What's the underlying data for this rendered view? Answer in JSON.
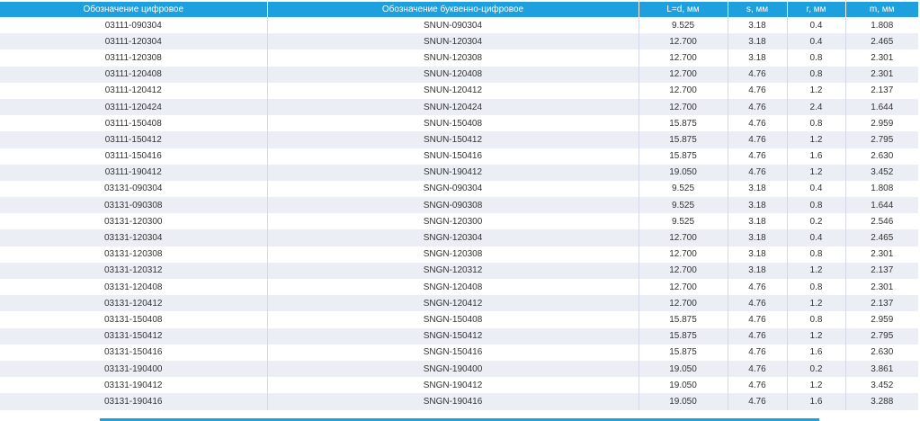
{
  "table": {
    "headers": [
      "Обозначение цифровое",
      "Обозначение буквенно-цифровое",
      "L=d, мм",
      "s, мм",
      "r, мм",
      "m, мм"
    ],
    "rows": [
      [
        "03111-090304",
        "SNUN-090304",
        "9.525",
        "3.18",
        "0.4",
        "1.808"
      ],
      [
        "03111-120304",
        "SNUN-120304",
        "12.700",
        "3.18",
        "0.4",
        "2.465"
      ],
      [
        "03111-120308",
        "SNUN-120308",
        "12.700",
        "3.18",
        "0.8",
        "2.301"
      ],
      [
        "03111-120408",
        "SNUN-120408",
        "12.700",
        "4.76",
        "0.8",
        "2.301"
      ],
      [
        "03111-120412",
        "SNUN-120412",
        "12.700",
        "4.76",
        "1.2",
        "2.137"
      ],
      [
        "03111-120424",
        "SNUN-120424",
        "12.700",
        "4.76",
        "2.4",
        "1.644"
      ],
      [
        "03111-150408",
        "SNUN-150408",
        "15.875",
        "4.76",
        "0.8",
        "2.959"
      ],
      [
        "03111-150412",
        "SNUN-150412",
        "15.875",
        "4.76",
        "1.2",
        "2.795"
      ],
      [
        "03111-150416",
        "SNUN-150416",
        "15.875",
        "4.76",
        "1.6",
        "2.630"
      ],
      [
        "03111-190412",
        "SNUN-190412",
        "19.050",
        "4.76",
        "1.2",
        "3.452"
      ],
      [
        "03131-090304",
        "SNGN-090304",
        "9.525",
        "3.18",
        "0.4",
        "1.808"
      ],
      [
        "03131-090308",
        "SNGN-090308",
        "9.525",
        "3.18",
        "0.8",
        "1.644"
      ],
      [
        "03131-120300",
        "SNGN-120300",
        "9.525",
        "3.18",
        "0.2",
        "2.546"
      ],
      [
        "03131-120304",
        "SNGN-120304",
        "12.700",
        "3.18",
        "0.4",
        "2.465"
      ],
      [
        "03131-120308",
        "SNGN-120308",
        "12.700",
        "3.18",
        "0.8",
        "2.301"
      ],
      [
        "03131-120312",
        "SNGN-120312",
        "12.700",
        "3.18",
        "1.2",
        "2.137"
      ],
      [
        "03131-120408",
        "SNGN-120408",
        "12.700",
        "4.76",
        "0.8",
        "2.301"
      ],
      [
        "03131-120412",
        "SNGN-120412",
        "12.700",
        "4.76",
        "1.2",
        "2.137"
      ],
      [
        "03131-150408",
        "SNGN-150408",
        "15.875",
        "4.76",
        "0.8",
        "2.959"
      ],
      [
        "03131-150412",
        "SNGN-150412",
        "15.875",
        "4.76",
        "1.2",
        "2.795"
      ],
      [
        "03131-150416",
        "SNGN-150416",
        "15.875",
        "4.76",
        "1.6",
        "2.630"
      ],
      [
        "03131-190400",
        "SNGN-190400",
        "19.050",
        "4.76",
        "0.2",
        "3.861"
      ],
      [
        "03131-190412",
        "SNGN-190412",
        "19.050",
        "4.76",
        "1.2",
        "3.452"
      ],
      [
        "03131-190416",
        "SNGN-190416",
        "19.050",
        "4.76",
        "1.6",
        "3.288"
      ]
    ]
  },
  "colors": {
    "header_bg": "#1e9fde",
    "header_text": "#ffffff",
    "row_alt_bg": "#eceef6",
    "row_bg": "#ffffff",
    "text": "#333333"
  }
}
